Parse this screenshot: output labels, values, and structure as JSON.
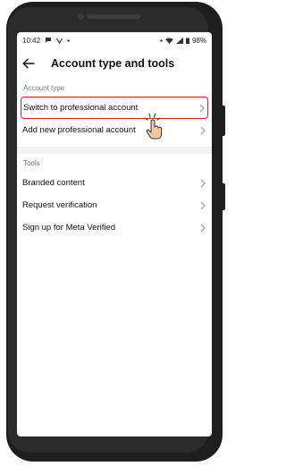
{
  "status_bar": {
    "time": "10:42",
    "battery": "98%",
    "icons_left": [
      "chat-icon",
      "v-icon",
      "dot-icon"
    ],
    "icons_right": [
      "dot-icon",
      "wifi-icon",
      "signal-icon",
      "battery-icon"
    ]
  },
  "header": {
    "title": "Account type and tools",
    "back_icon": "arrow-left-icon"
  },
  "sections": {
    "account_type": {
      "label": "Account type",
      "items": [
        {
          "label": "Switch to professional account",
          "highlighted": true
        },
        {
          "label": "Add new professional account"
        }
      ]
    },
    "tools": {
      "label": "Tools",
      "items": [
        {
          "label": "Branded content"
        },
        {
          "label": "Request verification"
        },
        {
          "label": "Sign up for Meta Verified"
        }
      ]
    }
  },
  "colors": {
    "highlight": "#d9262b",
    "pointer_fill": "#f6c89f"
  }
}
